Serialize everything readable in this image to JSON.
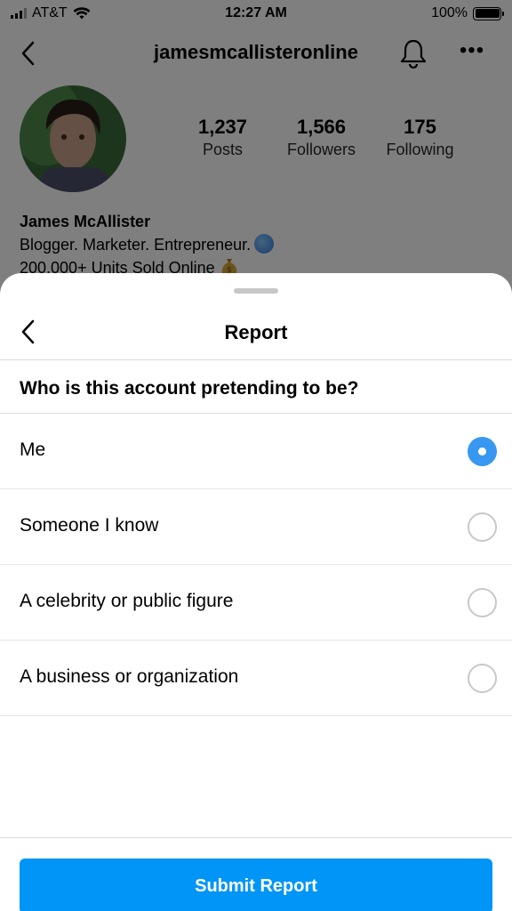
{
  "status_bar": {
    "carrier": "AT&T",
    "time": "12:27 AM",
    "battery": "100%"
  },
  "profile": {
    "username": "jamesmcallisteronline",
    "stats": [
      {
        "value": "1,237",
        "label": "Posts"
      },
      {
        "value": "1,566",
        "label": "Followers"
      },
      {
        "value": "175",
        "label": "Following"
      }
    ],
    "name": "James McAllister",
    "bio_line1": "Blogger. Marketer. Entrepreneur.",
    "bio_line2": "200,000+ Units Sold Online"
  },
  "sheet": {
    "title": "Report",
    "question": "Who is this account pretending to be?",
    "options": [
      {
        "label": "Me",
        "selected": true
      },
      {
        "label": "Someone I know",
        "selected": false
      },
      {
        "label": "A celebrity or public figure",
        "selected": false
      },
      {
        "label": "A business or organization",
        "selected": false
      }
    ],
    "submit_label": "Submit Report"
  },
  "colors": {
    "accent": "#0095f6",
    "radio_selected": "#3897f0",
    "overlay": "rgba(0,0,0,0.5)"
  },
  "icons": {
    "back": "chevron-left-icon",
    "notifications": "bell-icon",
    "more": "more-horizontal-icon",
    "globe": "globe-emoji",
    "money_bag": "money-bag-emoji"
  }
}
